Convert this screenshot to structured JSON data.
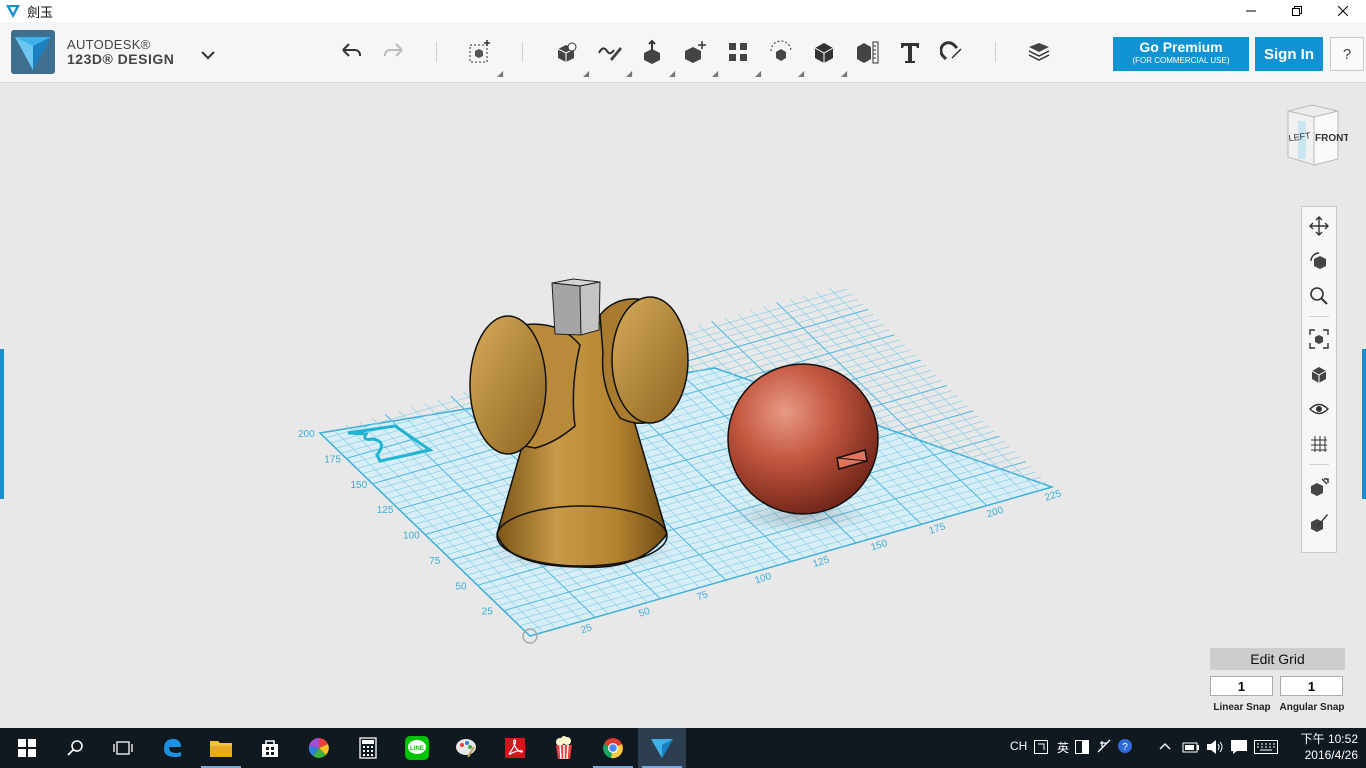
{
  "window": {
    "title": "劍玉",
    "minimize_icon": "minimize-icon",
    "maximize_icon": "restore-icon",
    "close_icon": "close-icon"
  },
  "brand": {
    "line1": "AUTODESK®",
    "line2": "123D® DESIGN",
    "menu_icon": "chevron-down-icon"
  },
  "toolbar": {
    "tools": [
      {
        "name": "undo-button",
        "icon": "undo-icon"
      },
      {
        "name": "redo-button",
        "icon": "redo-icon"
      },
      {
        "name": "transform-button",
        "icon": "transform-icon"
      },
      {
        "name": "primitives-button",
        "icon": "primitives-icon"
      },
      {
        "name": "sketch-button",
        "icon": "sketch-icon"
      },
      {
        "name": "construct-button",
        "icon": "construct-icon"
      },
      {
        "name": "modify-button",
        "icon": "modify-icon"
      },
      {
        "name": "pattern-button",
        "icon": "pattern-icon"
      },
      {
        "name": "group-button",
        "icon": "group-icon"
      },
      {
        "name": "combine-button",
        "icon": "combine-icon"
      },
      {
        "name": "measure-button",
        "icon": "measure-icon"
      },
      {
        "name": "text-button",
        "icon": "text-icon"
      },
      {
        "name": "snap-button",
        "icon": "snap-icon"
      },
      {
        "name": "materials-button",
        "icon": "layers-icon"
      }
    ],
    "premium_label": "Go Premium",
    "premium_sub": "(FOR COMMERCIAL USE)",
    "signin_label": "Sign In",
    "help_label": "?"
  },
  "viewcube": {
    "left_label": "LEFT",
    "front_label": "FRONT"
  },
  "grid": {
    "left_ticks": [
      "25",
      "50",
      "75",
      "100",
      "125",
      "150",
      "175",
      "200"
    ],
    "front_ticks": [
      "25",
      "50",
      "75",
      "100",
      "125",
      "150",
      "175",
      "200",
      "225"
    ]
  },
  "navbar": {
    "items": [
      "pan-icon",
      "orbit-icon",
      "zoom-icon",
      "fit-icon",
      "view-icon",
      "visibility-icon",
      "grid-icon",
      "snap-icon",
      "material-icon"
    ]
  },
  "edit_grid": {
    "label": "Edit Grid",
    "linear_value": "1",
    "angular_value": "1",
    "linear_label": "Linear Snap",
    "angular_label": "Angular Snap"
  },
  "taskbar": {
    "apps": [
      "start-icon",
      "search-icon",
      "task-view-icon",
      "edge-icon",
      "explorer-icon",
      "store-icon",
      "picasa-icon",
      "calculator-icon",
      "line-icon",
      "paint-icon",
      "acrobat-icon",
      "popcorn-icon",
      "chrome-icon",
      "123d-design-icon"
    ],
    "tray_lang": "CH",
    "tray_ime": "英",
    "time": "下午 10:52",
    "date": "2016/4/26"
  }
}
